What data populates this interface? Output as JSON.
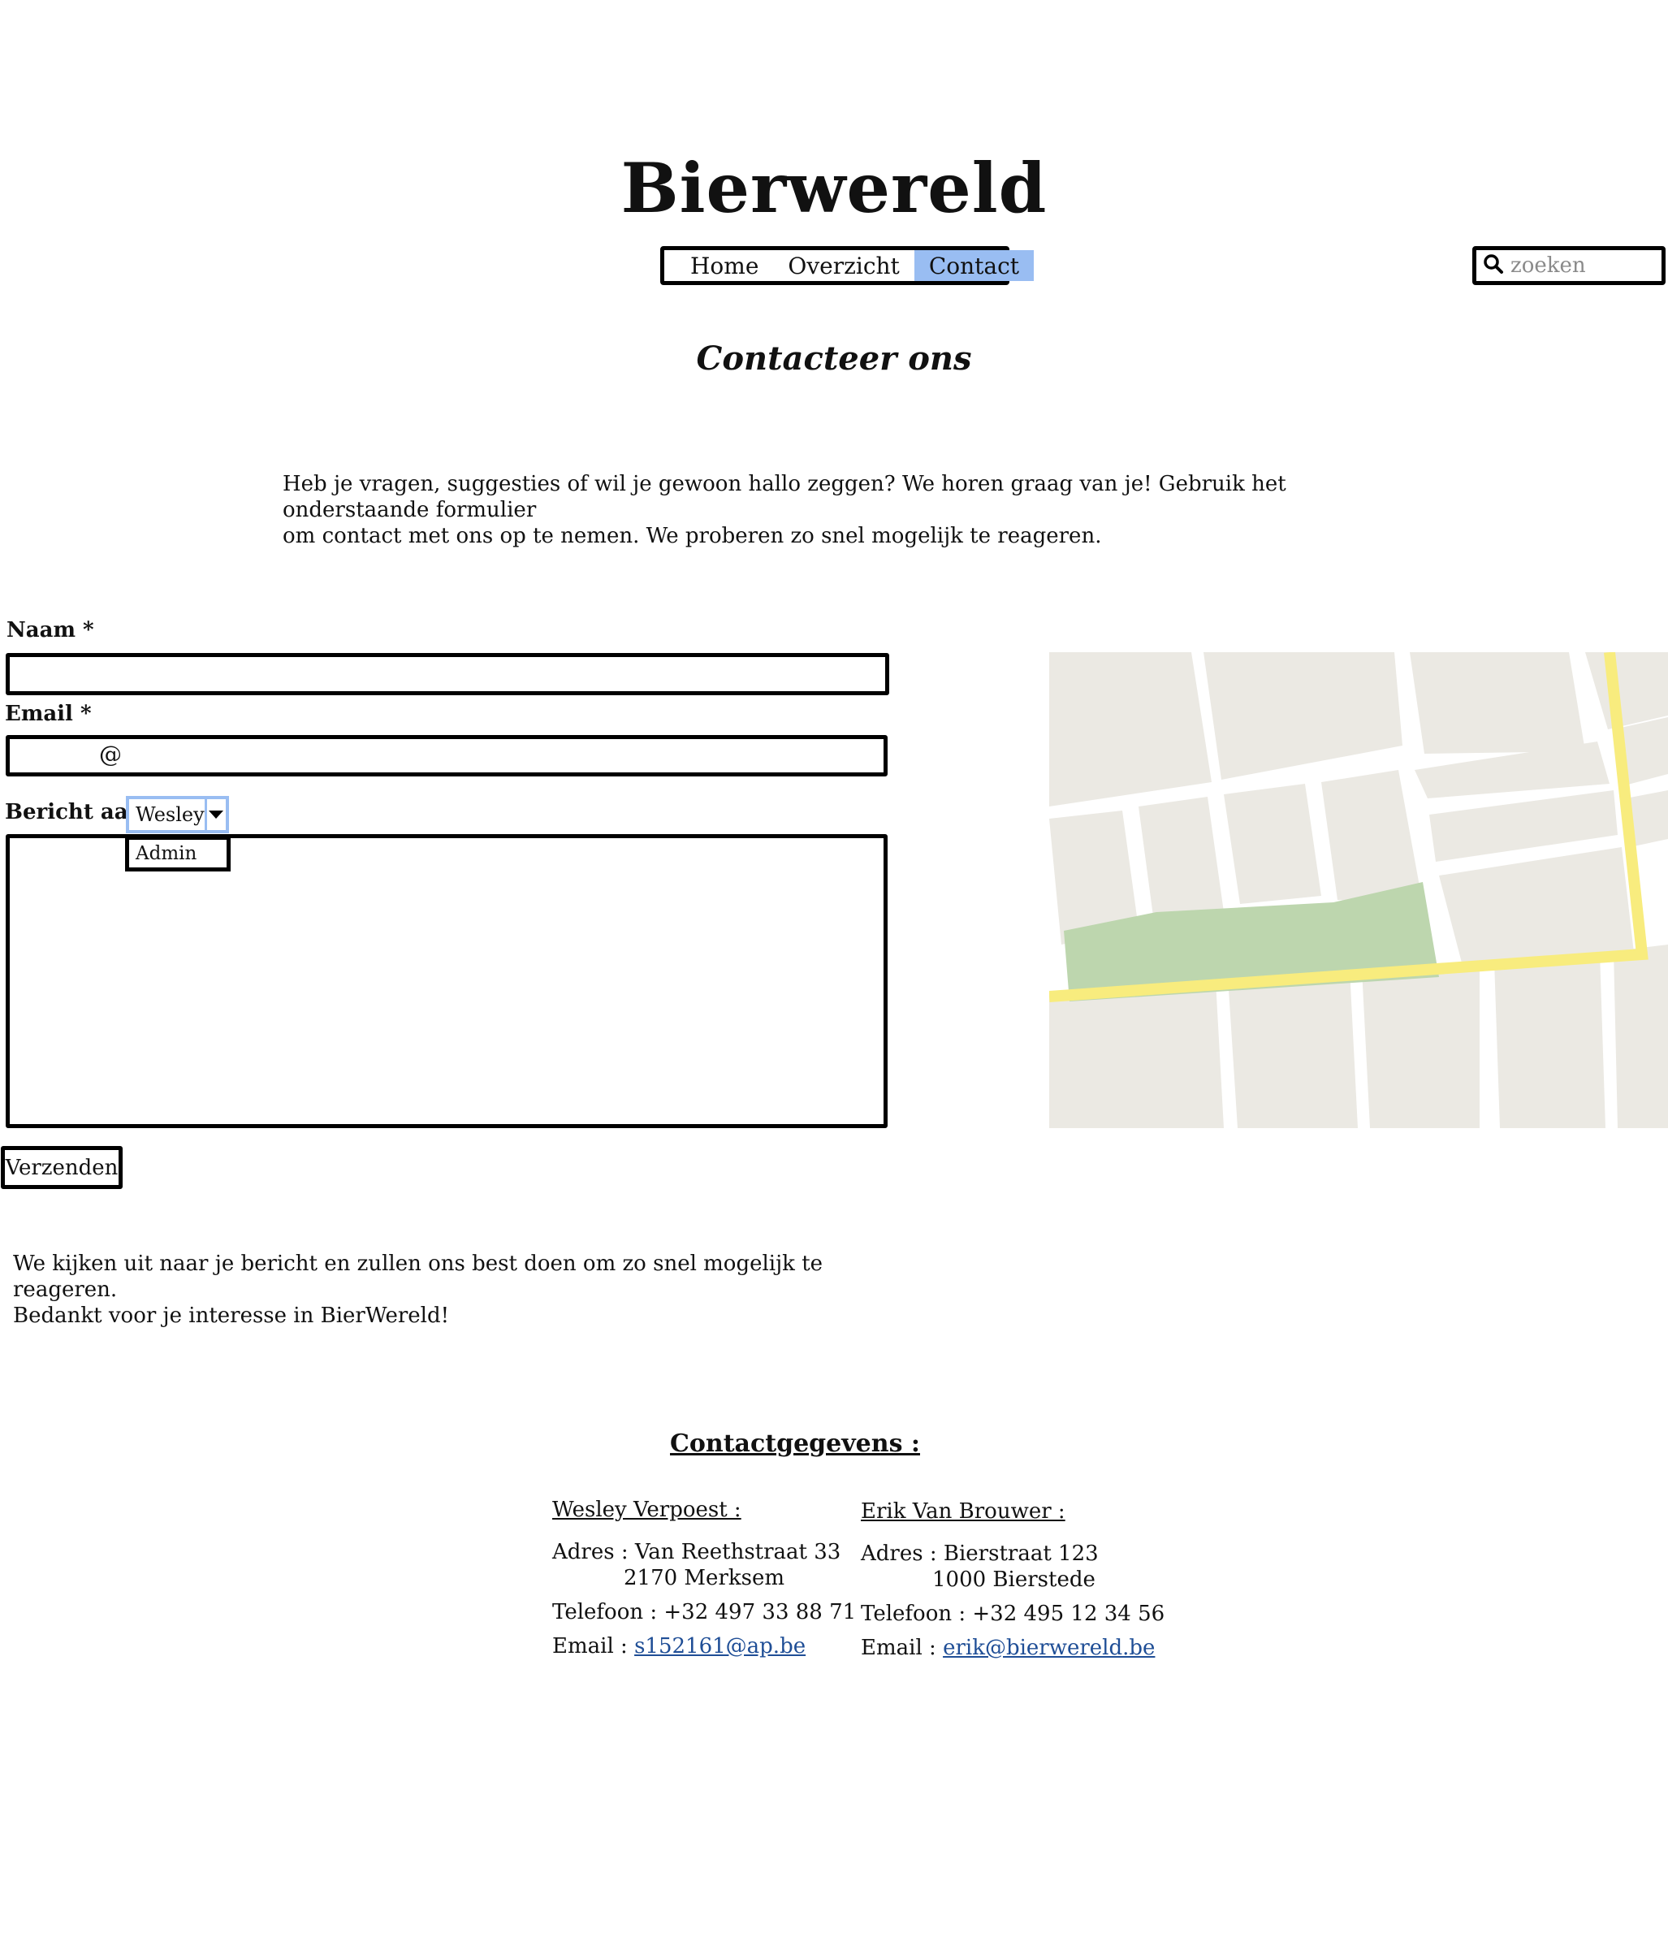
{
  "header": {
    "site_title": "Bierwereld",
    "nav": [
      {
        "label": "Home",
        "active": false
      },
      {
        "label": "Overzicht",
        "active": false
      },
      {
        "label": "Contact",
        "active": true
      }
    ],
    "search_placeholder": "zoeken",
    "search_icon": "search-icon"
  },
  "page": {
    "heading": "Contacteer ons",
    "intro_line1": "Heb je vragen, suggesties of wil je gewoon hallo zeggen? We horen graag van je! Gebruik het onderstaande formulier",
    "intro_line2": "om contact met ons op te nemen. We proberen zo snel mogelijk te reageren."
  },
  "form": {
    "name_label": "Naam *",
    "email_label": "Email *",
    "email_at": "@",
    "recipient_label": "Bericht aan",
    "recipient_selected": "Wesley",
    "recipient_options": [
      "Admin"
    ],
    "submit_label": "Verzenden"
  },
  "closing": {
    "line1": "We kijken uit naar je bericht en zullen ons best doen om zo snel mogelijk te reageren.",
    "line2": "Bedankt voor je interesse in BierWereld!"
  },
  "contact": {
    "title": "Contactgegevens : ",
    "people": [
      {
        "name": "Wesley Verpoest :",
        "address_prefix": "Adres : ",
        "street": "Van Reethstraat 33",
        "city": "2170 Merksem",
        "phone": "Telefoon : +32 497 33 88 71",
        "email_prefix": "Email : ",
        "email": "s152161@ap.be"
      },
      {
        "name": "Erik Van Brouwer :",
        "address_prefix": "Adres : ",
        "street": "Bierstraat 123",
        "city": "1000 Bierstede",
        "phone": "Telefoon : +32 495 12 34 56",
        "email_prefix": "Email : ",
        "email": "erik@bierwereld.be"
      }
    ]
  },
  "colors": {
    "nav_active": "#99bdf2",
    "link": "#1f4e96",
    "map_block": "#ebe9e3",
    "map_park": "#bdd6ae",
    "map_main_road": "#f8ec7e"
  }
}
